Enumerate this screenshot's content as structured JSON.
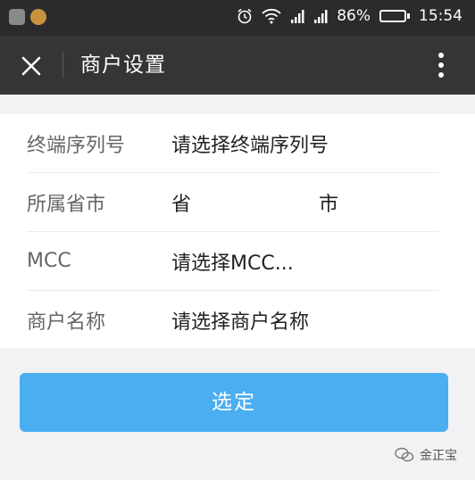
{
  "status_bar": {
    "battery": "86%",
    "battery_level": 0.86,
    "time": "15:54"
  },
  "app_bar": {
    "title": "商户设置"
  },
  "form": {
    "terminal_serial": {
      "label": "终端序列号",
      "value": "请选择终端序列号"
    },
    "region": {
      "label": "所属省市",
      "province": "省",
      "city": "市"
    },
    "mcc": {
      "label": "MCC",
      "value": "请选择MCC..."
    },
    "merchant_name": {
      "label": "商户名称",
      "value": "请选择商户名称"
    }
  },
  "confirm_button": {
    "label": "选定"
  },
  "watermark": {
    "text": "金正宝"
  },
  "colors": {
    "primary": "#4aaef0",
    "app_bar": "#353537",
    "status_bar": "#2b2b2d"
  }
}
